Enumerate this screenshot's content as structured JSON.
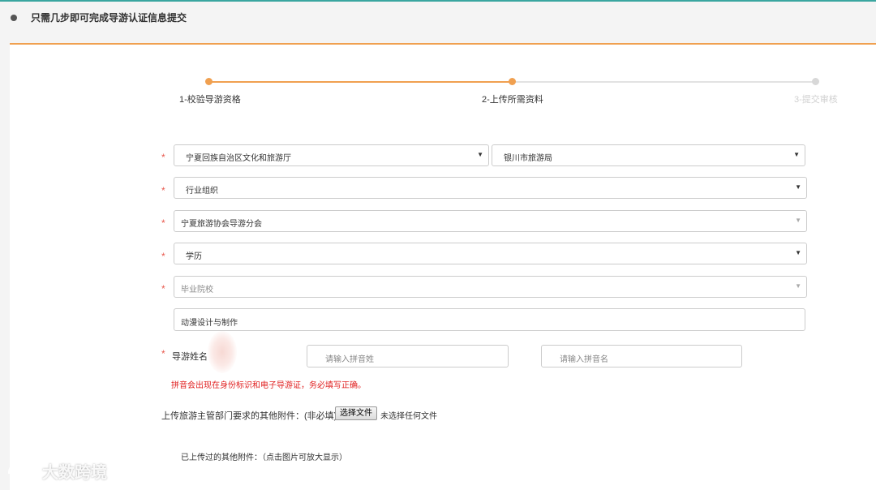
{
  "header": {
    "title": "只需几步即可完成导游认证信息提交"
  },
  "steps": [
    {
      "label": "1-校验导游资格",
      "state": "done"
    },
    {
      "label": "2-上传所需资料",
      "state": "active"
    },
    {
      "label": "3-提交审核",
      "state": "pending"
    }
  ],
  "form": {
    "province": "宁夏回族自治区文化和旅游厅",
    "city": "银川市旅游局",
    "org_type": "行业组织",
    "org_name": "宁夏旅游协会导游分会",
    "education": "学历",
    "school_placeholder": "毕业院校",
    "major": "动漫设计与制作",
    "name_label": "导游姓名",
    "surname_pinyin_placeholder": "请输入拼音姓",
    "given_pinyin_placeholder": "请输入拼音名",
    "pinyin_warning": "拼音会出现在身份标识和电子导游证，务必填写正确。",
    "attachment_label": "上传旅游主管部门要求的其他附件：(非必填)",
    "choose_file": "选择文件",
    "no_file": "未选择任何文件",
    "uploaded_label": "已上传过的其他附件：（点击图片可放大显示）"
  },
  "watermark": {
    "text": "大数跨境"
  },
  "colors": {
    "accent": "#f0a050",
    "required": "#e85a4f",
    "warning": "#e02020",
    "pending": "#d8d8d8"
  }
}
